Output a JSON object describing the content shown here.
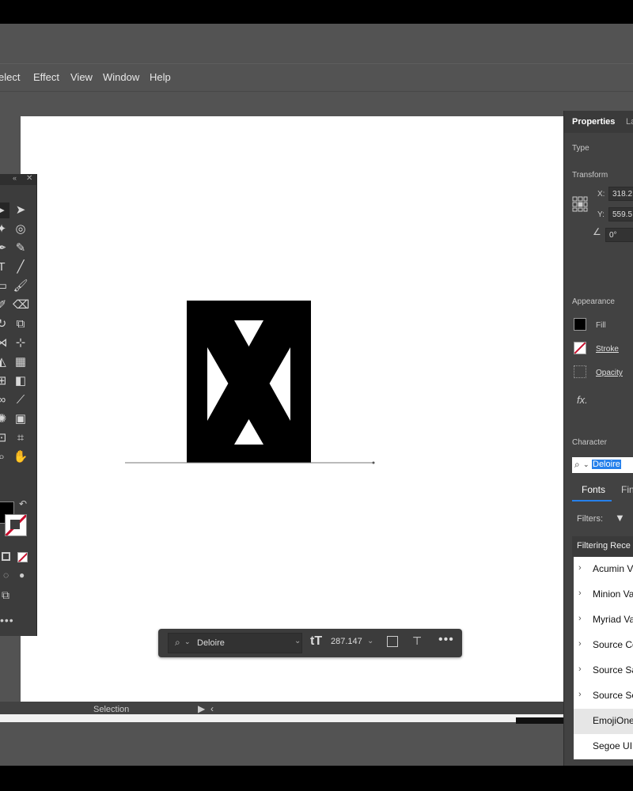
{
  "menu": {
    "items": [
      "elect",
      "Effect",
      "View",
      "Window",
      "Help"
    ]
  },
  "properties": {
    "tabs": [
      "Properties",
      "La"
    ],
    "type_label": "Type",
    "transform_label": "Transform",
    "x_label": "X:",
    "x_value": "318.2",
    "y_label": "Y:",
    "y_value": "559.5",
    "angle_value": "0°",
    "appearance_label": "Appearance",
    "fill_label": "Fill",
    "stroke_label": "Stroke",
    "opacity_label": "Opacity",
    "fx_label": "fx.",
    "character_label": "Character",
    "font_search_value": "Deloire",
    "font_tabs": [
      "Fonts",
      "Fin"
    ],
    "filters_label": "Filters:",
    "filtering_label": "Filtering Rece",
    "font_list": [
      "Acumin Va",
      "Minion Va",
      "Myriad Va",
      "Source Co",
      "Source Sa",
      "Source Se",
      "EmojiOne",
      "Segoe UI"
    ]
  },
  "floatbar": {
    "font_value": "Deloire",
    "size_value": "287.147"
  },
  "status": {
    "mode": "Selection"
  },
  "colors": {
    "app_bg": "#535353",
    "panel_bg": "#424242",
    "canvas": "#ffffff",
    "accent_blue": "#2680eb",
    "stroke_red": "#c8102e"
  }
}
